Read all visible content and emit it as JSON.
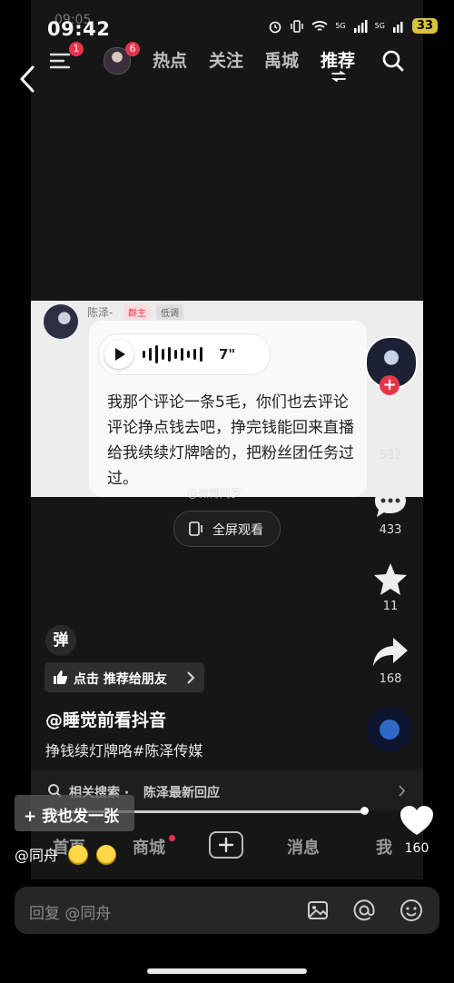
{
  "status": {
    "time": "09:42",
    "time_ghost": "09:05",
    "battery": "33",
    "net1": "5G",
    "net2": "5G"
  },
  "topnav": {
    "menu_badge": "1",
    "avatar_badge": "6",
    "tabs": [
      {
        "label": "热点"
      },
      {
        "label": "关注"
      },
      {
        "label": "禹城"
      },
      {
        "label": "推荐"
      }
    ]
  },
  "card": {
    "name": "陈泽-",
    "tag_owner": "群主",
    "tag_low": "低调",
    "voice_duration": "7\"",
    "message": "我那个评论一条5毛，你们也去评论评论挣点钱去吧，挣完钱能回来直播给我续续灯牌啥的，把粉丝团任务过过。"
  },
  "watermark": "@微博网罗",
  "fullscreen_label": "全屏观看",
  "actions": {
    "likes": "532",
    "comments": "433",
    "favorites": "11",
    "shares": "168"
  },
  "danmaku_label": "弹",
  "recommend_label": "点击 推荐给朋友",
  "author": "@睡觉前看抖音",
  "description": "挣钱续灯牌咯#陈泽传媒",
  "related": {
    "prefix": "相关搜索 · ",
    "query": "陈泽最新回应"
  },
  "snap_label": "+ 我也发一张",
  "bottom_tabs": {
    "home": "首页",
    "mall": "商城",
    "messages": "消息",
    "me": "我"
  },
  "mention": "@同舟",
  "big_like_count": "160",
  "reply_placeholder": "回复 @同舟"
}
